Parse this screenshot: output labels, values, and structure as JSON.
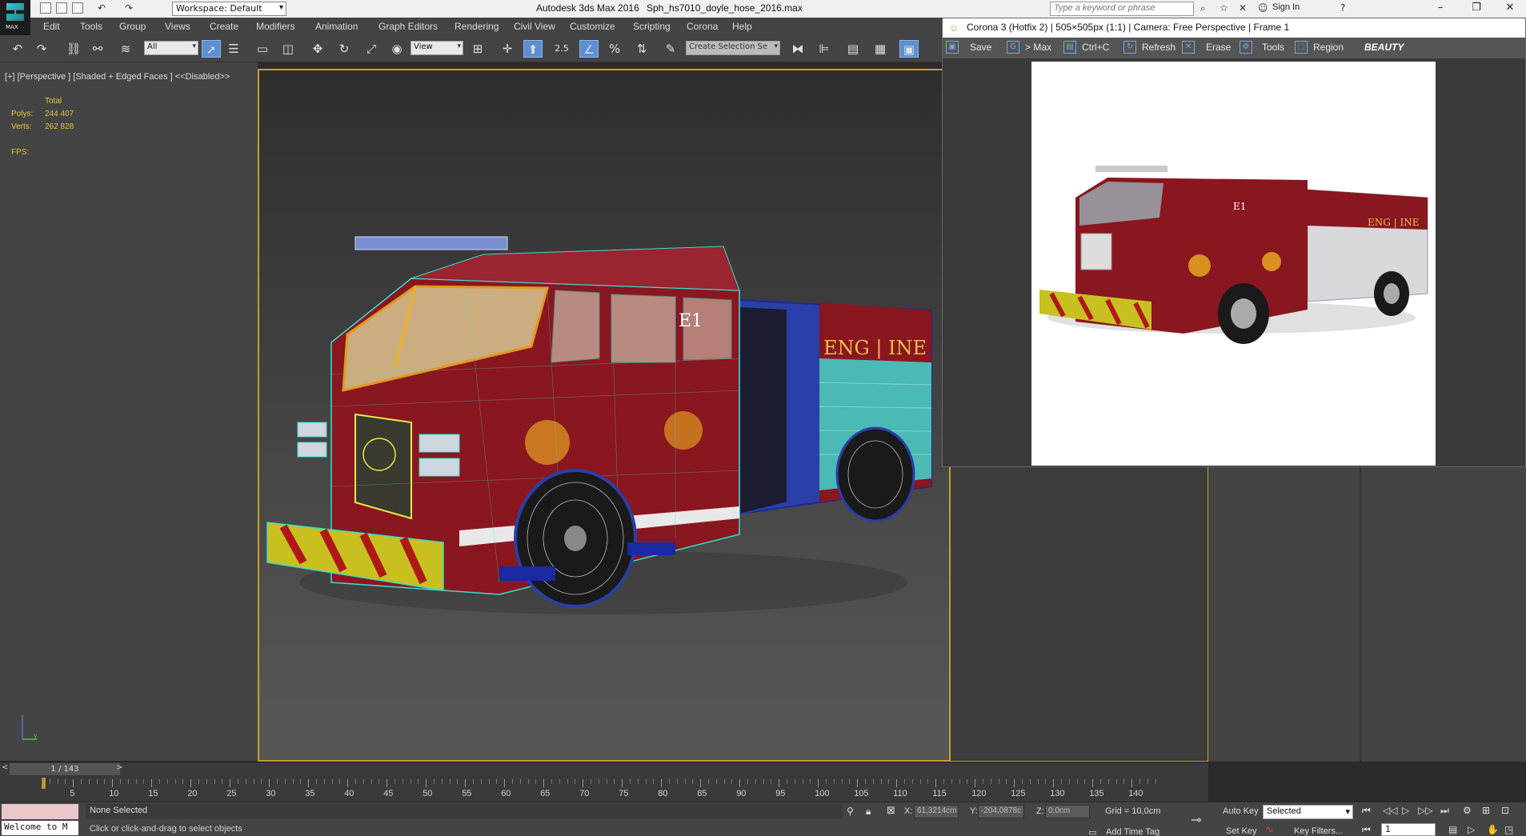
{
  "titlebar": {
    "workspace": "Workspace: Default",
    "app_title": "Autodesk 3ds Max 2016",
    "file_title": "Sph_hs7010_doyle_hose_2016.max",
    "search_placeholder": "Type a keyword or phrase",
    "sign_in": "Sign In",
    "logo_text": "MAX"
  },
  "menu": [
    "Edit",
    "Tools",
    "Group",
    "Views",
    "Create",
    "Modifiers",
    "Animation",
    "Graph Editors",
    "Rendering",
    "Civil View",
    "Customize",
    "Scripting",
    "Corona",
    "Help"
  ],
  "toolbar": {
    "selection_filter": "All",
    "reference_coord": "View",
    "snap_value": "2.5",
    "named_selection": "Create Selection Se"
  },
  "viewport": {
    "label": "[+] [Perspective ] [Shaded + Edged Faces ]  <<Disabled>>",
    "stats_header": "Total",
    "polys_label": "Polys:",
    "polys_value": "244 407",
    "verts_label": "Verts:",
    "verts_value": "262 828",
    "fps_label": "FPS:",
    "truck_door_text": "E1",
    "truck_side_text": "ENG | INE"
  },
  "render_window": {
    "title": "Corona 3 (Hotfix 2) | 505×505px (1:1) | Camera: Free Perspective | Frame 1",
    "buttons": [
      "Save",
      "> Max",
      "Ctrl+C",
      "Refresh",
      "Erase",
      "Tools",
      "Region"
    ],
    "channel": "BEAUTY"
  },
  "timeline": {
    "frame_counter": "1 / 143",
    "ticks": [
      "5",
      "10",
      "15",
      "20",
      "25",
      "30",
      "35",
      "40",
      "45",
      "50",
      "55",
      "60",
      "65",
      "70",
      "75",
      "80",
      "85",
      "90",
      "95",
      "100",
      "105",
      "110",
      "115",
      "120",
      "125",
      "130",
      "135",
      "140"
    ]
  },
  "status": {
    "maxscript_text": "Welcome to M",
    "selection": "None Selected",
    "prompt": "Click or click-and-drag to select objects",
    "x_label": "X:",
    "x_value": "61,3214cm",
    "y_label": "Y:",
    "y_value": "-204,0878c",
    "z_label": "Z:",
    "z_value": "0,0cm",
    "grid": "Grid = 10,0cm",
    "add_time_tag": "Add Time Tag",
    "auto_key": "Auto Key",
    "set_key": "Set Key",
    "key_mode": "Selected",
    "key_filters": "Key Filters...",
    "current_frame": "1"
  },
  "colors": {
    "viewport_border": "#c8a020",
    "stats_text": "#e3c83a",
    "active_button": "#5d8fd1",
    "wire_cyan": "#33e0d0",
    "truck_red": "#8a1620"
  }
}
